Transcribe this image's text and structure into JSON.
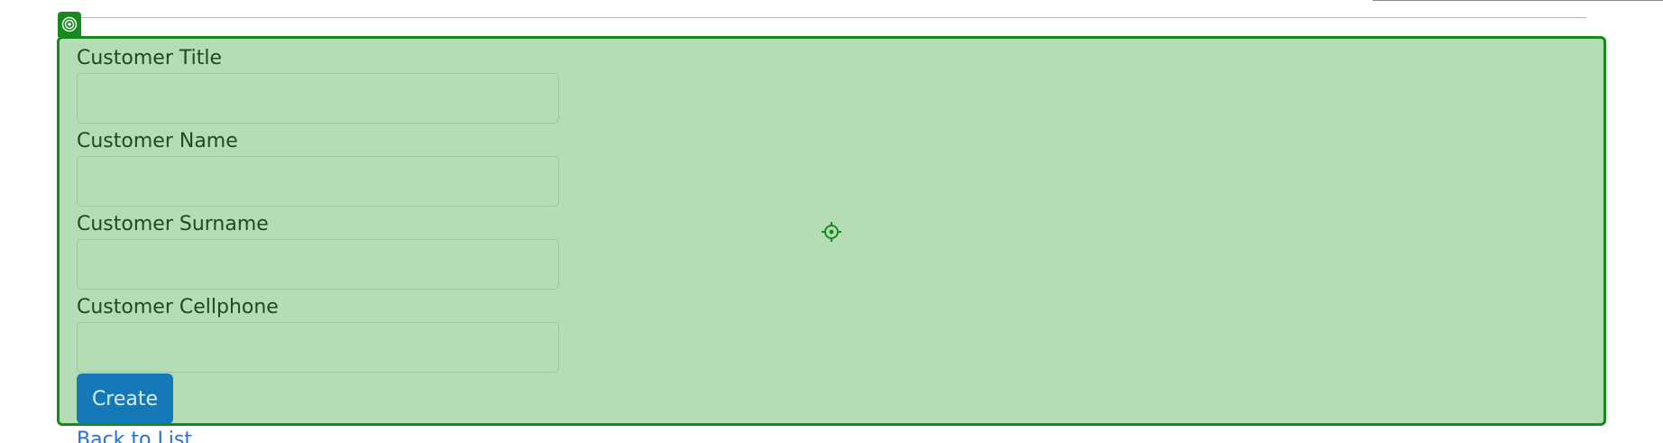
{
  "form": {
    "fields": [
      {
        "label": "Customer Title",
        "value": "",
        "placeholder": ""
      },
      {
        "label": "Customer Name",
        "value": "",
        "placeholder": ""
      },
      {
        "label": "Customer Surname",
        "value": "",
        "placeholder": ""
      },
      {
        "label": "Customer Cellphone",
        "value": "",
        "placeholder": ""
      }
    ],
    "create_label": "Create"
  },
  "back_link": {
    "label": "Back to List"
  },
  "icons": {
    "badge": "target-icon",
    "center_marker": "crosshair-icon"
  },
  "colors": {
    "overlay_fill": "#b4ddb5",
    "overlay_border": "#178a1d",
    "button": "#1579b8",
    "link": "#2a6fd6"
  }
}
